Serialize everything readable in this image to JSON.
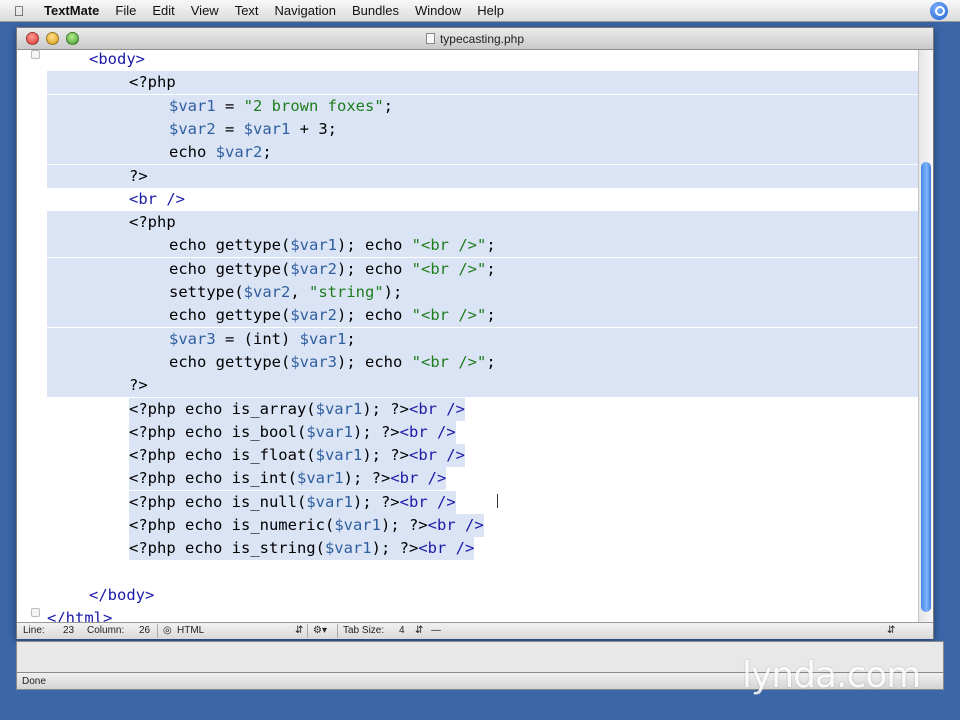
{
  "menubar": {
    "app_name": "TextMate",
    "items": [
      "File",
      "Edit",
      "View",
      "Text",
      "Navigation",
      "Bundles",
      "Window",
      "Help"
    ]
  },
  "window": {
    "title": "typecasting.php"
  },
  "code_lines": [
    {
      "tokens": [
        {
          "t": "<body>",
          "c": "tag"
        }
      ]
    },
    {
      "tokens": [
        {
          "t": "<?php",
          "c": ""
        }
      ]
    },
    {
      "tokens": [
        {
          "t": "$var1",
          "c": "var"
        },
        {
          "t": " = ",
          "c": ""
        },
        {
          "t": "\"2 brown foxes\"",
          "c": "str"
        },
        {
          "t": ";",
          "c": ""
        }
      ]
    },
    {
      "tokens": [
        {
          "t": "$var2",
          "c": "var"
        },
        {
          "t": " = ",
          "c": ""
        },
        {
          "t": "$var1",
          "c": "var"
        },
        {
          "t": " + 3;",
          "c": ""
        }
      ]
    },
    {
      "tokens": [
        {
          "t": "echo ",
          "c": ""
        },
        {
          "t": "$var2",
          "c": "var"
        },
        {
          "t": ";",
          "c": ""
        }
      ]
    },
    {
      "tokens": [
        {
          "t": "?>",
          "c": ""
        }
      ]
    },
    {
      "tokens": [
        {
          "t": "<br />",
          "c": "tag"
        }
      ]
    },
    {
      "tokens": [
        {
          "t": "<?php",
          "c": ""
        }
      ]
    },
    {
      "tokens": [
        {
          "t": "echo gettype(",
          "c": ""
        },
        {
          "t": "$var1",
          "c": "var"
        },
        {
          "t": "); echo ",
          "c": ""
        },
        {
          "t": "\"<br />\"",
          "c": "str"
        },
        {
          "t": ";",
          "c": ""
        }
      ]
    },
    {
      "tokens": [
        {
          "t": "echo gettype(",
          "c": ""
        },
        {
          "t": "$var2",
          "c": "var"
        },
        {
          "t": "); echo ",
          "c": ""
        },
        {
          "t": "\"<br />\"",
          "c": "str"
        },
        {
          "t": ";",
          "c": ""
        }
      ]
    },
    {
      "tokens": [
        {
          "t": "settype(",
          "c": ""
        },
        {
          "t": "$var2",
          "c": "var"
        },
        {
          "t": ", ",
          "c": ""
        },
        {
          "t": "\"string\"",
          "c": "str"
        },
        {
          "t": ");",
          "c": ""
        }
      ]
    },
    {
      "tokens": [
        {
          "t": "echo gettype(",
          "c": ""
        },
        {
          "t": "$var2",
          "c": "var"
        },
        {
          "t": "); echo ",
          "c": ""
        },
        {
          "t": "\"<br />\"",
          "c": "str"
        },
        {
          "t": ";",
          "c": ""
        }
      ]
    },
    {
      "tokens": [
        {
          "t": "$var3",
          "c": "var"
        },
        {
          "t": " = (int) ",
          "c": ""
        },
        {
          "t": "$var1",
          "c": "var"
        },
        {
          "t": ";",
          "c": ""
        }
      ]
    },
    {
      "tokens": [
        {
          "t": "echo gettype(",
          "c": ""
        },
        {
          "t": "$var3",
          "c": "var"
        },
        {
          "t": "); echo ",
          "c": ""
        },
        {
          "t": "\"<br />\"",
          "c": "str"
        },
        {
          "t": ";",
          "c": ""
        }
      ]
    },
    {
      "tokens": [
        {
          "t": "?>",
          "c": ""
        }
      ]
    },
    {
      "tokens": [
        {
          "t": "<?php echo is_array(",
          "c": ""
        },
        {
          "t": "$var1",
          "c": "var"
        },
        {
          "t": "); ?>",
          "c": ""
        },
        {
          "t": "<br />",
          "c": "tag"
        }
      ]
    },
    {
      "tokens": [
        {
          "t": "<?php echo is_bool(",
          "c": ""
        },
        {
          "t": "$var1",
          "c": "var"
        },
        {
          "t": "); ?>",
          "c": ""
        },
        {
          "t": "<br />",
          "c": "tag"
        }
      ]
    },
    {
      "tokens": [
        {
          "t": "<?php echo is_float(",
          "c": ""
        },
        {
          "t": "$var1",
          "c": "var"
        },
        {
          "t": "); ?>",
          "c": ""
        },
        {
          "t": "<br />",
          "c": "tag"
        }
      ]
    },
    {
      "tokens": [
        {
          "t": "<?php echo is_int(",
          "c": ""
        },
        {
          "t": "$var1",
          "c": "var"
        },
        {
          "t": "); ?>",
          "c": ""
        },
        {
          "t": "<br />",
          "c": "tag"
        }
      ]
    },
    {
      "tokens": [
        {
          "t": "<?php echo is_null(",
          "c": ""
        },
        {
          "t": "$var1",
          "c": "var"
        },
        {
          "t": "); ?>",
          "c": ""
        },
        {
          "t": "<br />",
          "c": "tag"
        }
      ]
    },
    {
      "tokens": [
        {
          "t": "<?php echo is_numeric(",
          "c": ""
        },
        {
          "t": "$var1",
          "c": "var"
        },
        {
          "t": "); ?>",
          "c": ""
        },
        {
          "t": "<br />",
          "c": "tag"
        }
      ]
    },
    {
      "tokens": [
        {
          "t": "<?php echo is_string(",
          "c": ""
        },
        {
          "t": "$var1",
          "c": "var"
        },
        {
          "t": "); ?>",
          "c": ""
        },
        {
          "t": "<br />",
          "c": "tag"
        }
      ]
    },
    {
      "tokens": []
    },
    {
      "tokens": [
        {
          "t": "</body>",
          "c": "tag"
        }
      ]
    },
    {
      "tokens": [
        {
          "t": "</html>",
          "c": "tag"
        }
      ]
    }
  ],
  "statusbar": {
    "line_label": "Line:",
    "line_value": "23",
    "column_label": "Column:",
    "column_value": "26",
    "language": "HTML",
    "tab_size_label": "Tab Size:",
    "tab_size_value": "4",
    "symbol": "—"
  },
  "bottom": {
    "status": "Done",
    "brand": "lynda.com"
  }
}
